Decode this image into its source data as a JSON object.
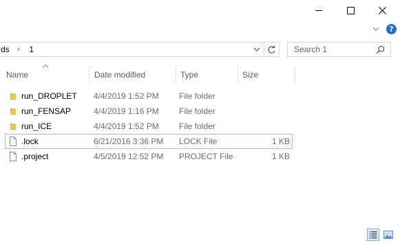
{
  "window": {
    "minimize_icon": "minimize-icon",
    "maximize_icon": "maximize-icon",
    "close_icon": "close-icon"
  },
  "ribbon": {
    "help_label": "?"
  },
  "address": {
    "crumb_tail": "ds",
    "separator": "›",
    "current": "1"
  },
  "search": {
    "placeholder": "Search 1",
    "value": ""
  },
  "columns": {
    "name": "Name",
    "date": "Date modified",
    "type": "Type",
    "size": "Size"
  },
  "files": [
    {
      "name": "run_DROPLET",
      "date": "4/4/2019 1:52 PM",
      "type": "File folder",
      "size": "",
      "icon": "folder-icon"
    },
    {
      "name": "run_FENSAP",
      "date": "4/4/2019 1:16 PM",
      "type": "File folder",
      "size": "",
      "icon": "folder-icon"
    },
    {
      "name": "run_ICE",
      "date": "4/4/2019 1:52 PM",
      "type": "File folder",
      "size": "",
      "icon": "folder-icon"
    },
    {
      "name": ".lock",
      "date": "6/21/2016 3:36 PM",
      "type": "LOCK File",
      "size": "1 KB",
      "icon": "file-icon"
    },
    {
      "name": ".project",
      "date": "4/5/2019 12:52 PM",
      "type": "PROJECT File",
      "size": "1 KB",
      "icon": "file-icon"
    }
  ],
  "colors": {
    "accent": "#1e6fd0",
    "header_text": "#4c607a",
    "detail_text": "#6d6d6d",
    "folder": "#f0c24a",
    "focus_border": "#99c2eb"
  }
}
